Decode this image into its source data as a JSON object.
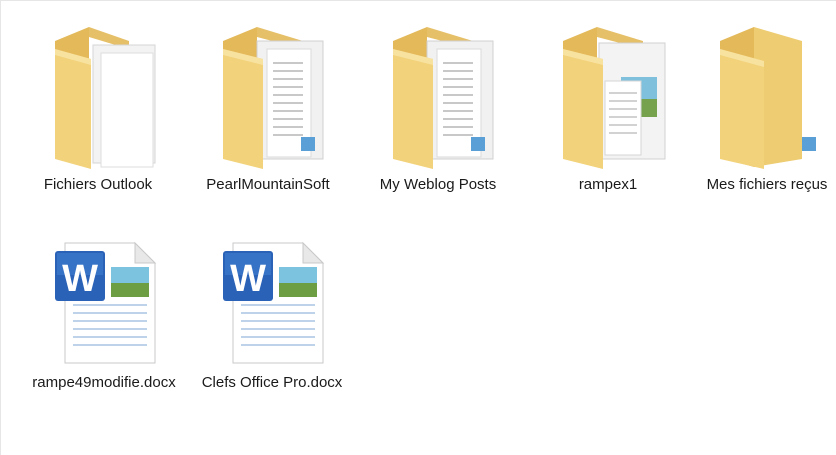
{
  "view": {
    "items": [
      {
        "name": "Fichiers Outlook",
        "type": "folder",
        "variant": "papers-open",
        "icon": "folder-icon"
      },
      {
        "name": "PearlMountainSoft",
        "type": "folder",
        "variant": "documents",
        "icon": "folder-icon"
      },
      {
        "name": "My Weblog Posts",
        "type": "folder",
        "variant": "documents",
        "icon": "folder-icon"
      },
      {
        "name": "rampex1",
        "type": "folder",
        "variant": "pictures",
        "icon": "folder-icon"
      },
      {
        "name": "Mes fichiers reçus",
        "type": "folder",
        "variant": "empty",
        "icon": "folder-icon"
      },
      {
        "name": "rampe49modifie.docx",
        "type": "file",
        "variant": "word",
        "icon": "word-document-icon"
      },
      {
        "name": "Clefs Office Pro.docx",
        "type": "file",
        "variant": "word",
        "icon": "word-document-icon"
      }
    ]
  },
  "colors": {
    "folder_back": "#e9c66a",
    "folder_front": "#f6d985",
    "word_blue": "#2a62b8"
  }
}
